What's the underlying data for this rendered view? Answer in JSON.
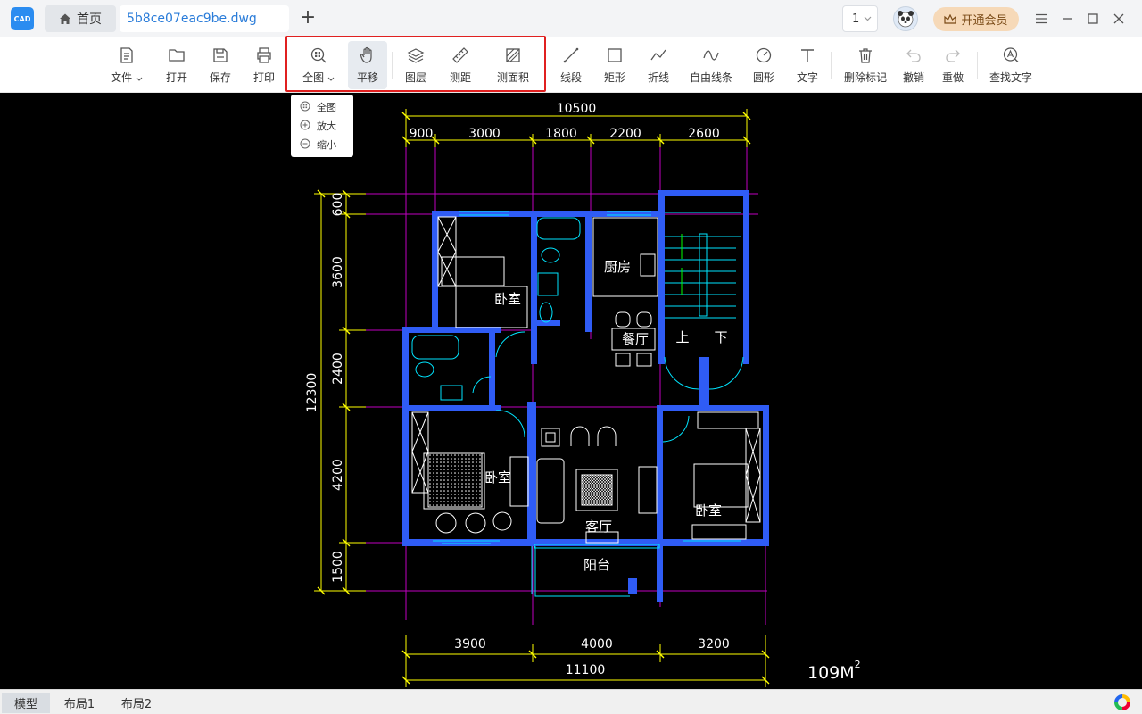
{
  "app": {
    "logo_text": "CAD"
  },
  "tabs": {
    "home_label": "首页",
    "file_label": "5b8ce07eac9be.dwg",
    "add_label": "+"
  },
  "header": {
    "page_value": "1",
    "vip_label": "开通会员"
  },
  "toolbar": {
    "file": "文件",
    "open": "打开",
    "save": "保存",
    "print": "打印",
    "fullview": "全图",
    "pan": "平移",
    "layers": "图层",
    "measure_distance": "测距",
    "measure_area": "测面积",
    "line": "线段",
    "rect": "矩形",
    "polyline": "折线",
    "freeline": "自由线条",
    "circle": "圆形",
    "text": "文字",
    "delete_marks": "删除标记",
    "undo": "撤销",
    "redo": "重做",
    "find_text": "查找文字"
  },
  "view_menu": {
    "items": [
      "全图",
      "放大",
      "缩小"
    ]
  },
  "drawing": {
    "top_total": "10500",
    "top_dims": [
      "900",
      "3000",
      "1800",
      "2200",
      "2600"
    ],
    "left_total": "12300",
    "left_dims": [
      "600",
      "3600",
      "2400",
      "4200",
      "1500"
    ],
    "bottom_dims": [
      "3900",
      "4000",
      "3200"
    ],
    "bottom_total": "11100",
    "rooms": [
      "卧室",
      "厨房",
      "餐厅",
      "上",
      "下",
      "卧室",
      "客厅",
      "卧室",
      "阳台"
    ],
    "area_label": "109M",
    "area_sup": "2"
  },
  "bottom_tabs": [
    "模型",
    "布局1",
    "布局2"
  ],
  "colors": {
    "accent": "#2a7cd9",
    "highlight": "#e02020",
    "wall": "#2f5cf5",
    "dimension": "#ffff00",
    "grid": "#c000c0",
    "fixture": "#00e5ff"
  }
}
